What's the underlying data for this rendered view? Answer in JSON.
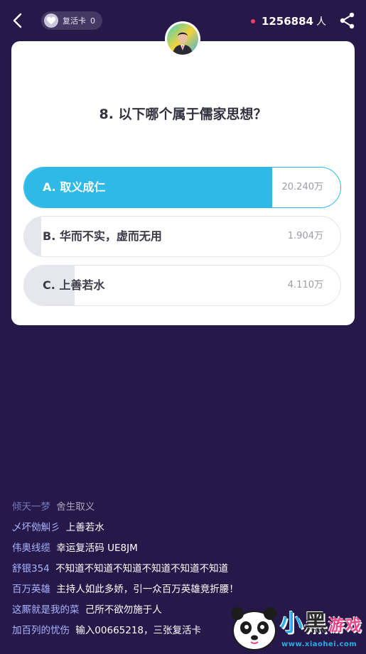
{
  "header": {
    "revive_label": "复活卡",
    "revive_count": "0",
    "viewer_count": "1256884",
    "viewer_unit": "人"
  },
  "question": {
    "text": "8. 以下哪个属于儒家思想？"
  },
  "options": [
    {
      "label": "A. 取义成仁",
      "count": "20.240万",
      "share": 0.785,
      "selected": true
    },
    {
      "label": "B. 华而不实，虚而无用",
      "count": "1.904万",
      "share": 0.055,
      "selected": false
    },
    {
      "label": "C. 上善若水",
      "count": "4.110万",
      "share": 0.16,
      "selected": false
    }
  ],
  "chat": [
    {
      "user": "倾天一梦",
      "msg": "舍生取义"
    },
    {
      "user": "乄坏俲觓彡",
      "msg": "上善若水"
    },
    {
      "user": "伟奥线缆",
      "msg": "幸运复活码 UE8JM"
    },
    {
      "user": "舒银354",
      "msg": "不知道不知道不知道不知道不知道不知道"
    },
    {
      "user": "百万英雄",
      "msg": "主持人如此多娇，引一众百万英雄竞折腰！"
    },
    {
      "user": "这厮就是我的菜",
      "msg": "己所不欲勿施于人"
    },
    {
      "user": "加百列的忧伤",
      "msg": "输入00665218，三张复活卡"
    }
  ],
  "watermark": {
    "text_xiao": "小",
    "text_hei": "黑",
    "text_game": "游戏",
    "url": "www.xiaohei.com"
  },
  "colors": {
    "background": "#26194a",
    "accent": "#2fb9e6",
    "username": "#a8b4ff",
    "live_dot": "#ff3a6c"
  }
}
